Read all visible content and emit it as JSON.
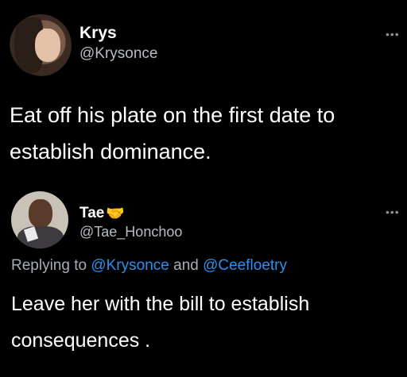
{
  "original_tweet": {
    "display_name": "Krys",
    "handle": "@Krysonce",
    "text": "Eat off his plate on the first date to establish dominance.",
    "more_menu": "•••",
    "avatar_icon": "profile-photo-avatar"
  },
  "reply_tweet": {
    "display_name": "Tae",
    "name_emoji": "🤝",
    "handle": "@Tae_Honchoo",
    "replying_prefix": "Replying to",
    "replying_mention_1": "@Krysonce",
    "replying_and": "and",
    "replying_mention_2": "@Ceefloetry",
    "text": "Leave her with the bill to establish consequences .",
    "more_menu": "•••",
    "avatar_icon": "profile-photo-avatar"
  },
  "colors": {
    "background": "#000000",
    "text": "#ffffff",
    "secondary_text": "#b8bcc2",
    "mention": "#2d8ff0"
  }
}
